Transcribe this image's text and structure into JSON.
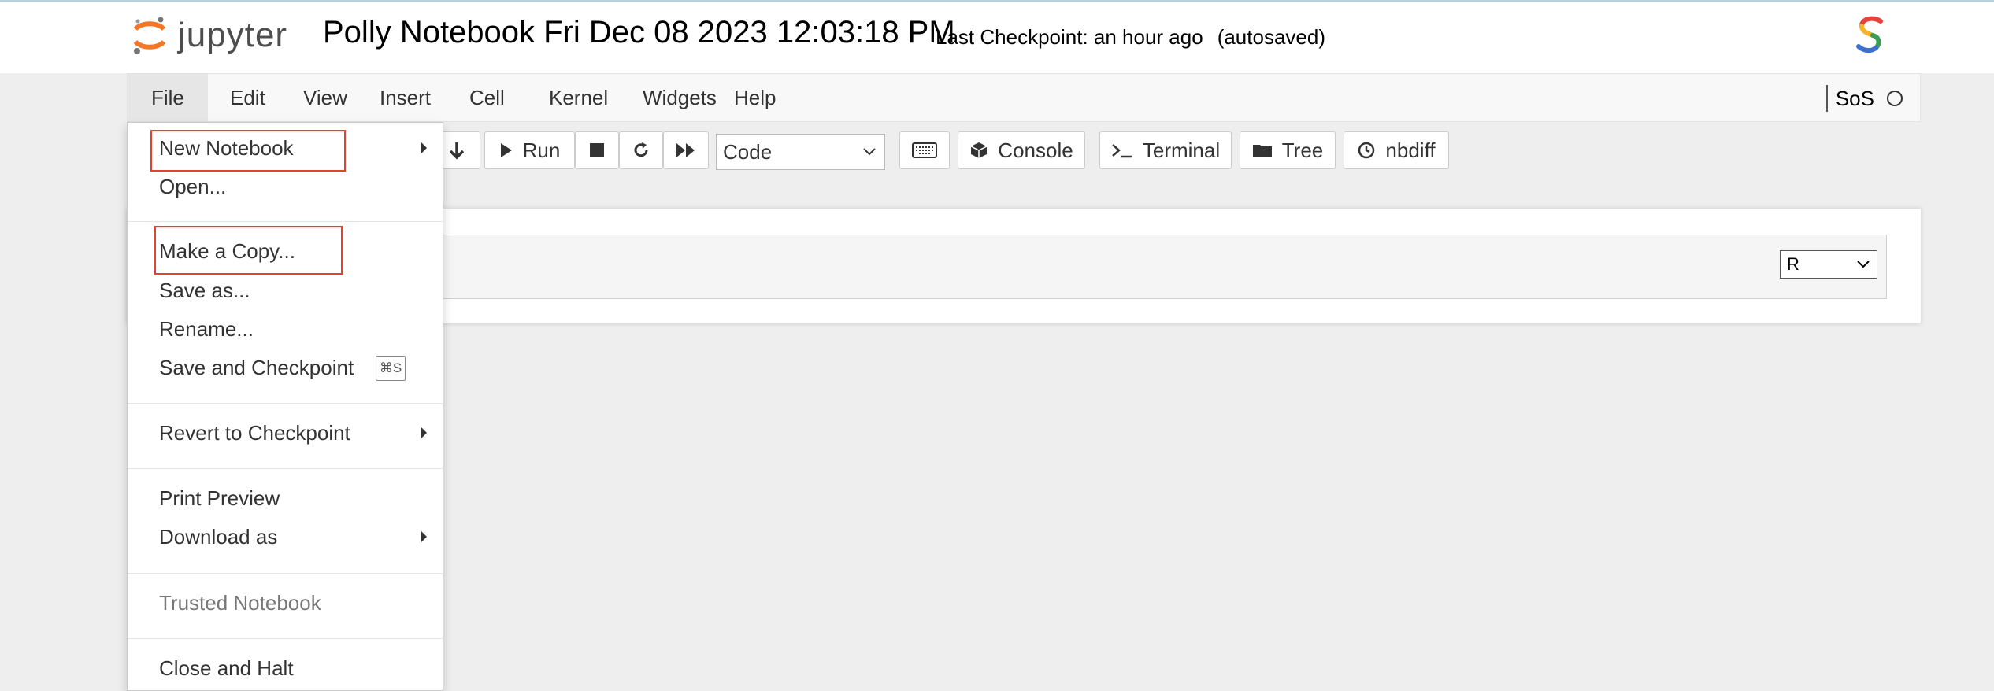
{
  "header": {
    "logo_text": "jupyter",
    "notebook_name": "Polly Notebook Fri Dec 08 2023 12:03:18 PM",
    "checkpoint": "Last Checkpoint: an hour ago",
    "autosave": "(autosaved)"
  },
  "menubar": {
    "items": [
      "File",
      "Edit",
      "View",
      "Insert",
      "Cell",
      "Kernel",
      "Widgets",
      "Help"
    ],
    "active": "File",
    "kernel_name": "SoS"
  },
  "toolbar": {
    "run_label": "Run",
    "cell_type": "Code",
    "console_label": "Console",
    "terminal_label": "Terminal",
    "tree_label": "Tree",
    "nbdiff_label": "nbdiff"
  },
  "cell": {
    "language": "R"
  },
  "file_menu": {
    "new_notebook": "New Notebook",
    "open": "Open...",
    "make_copy": "Make a Copy...",
    "save_as": "Save as...",
    "rename": "Rename...",
    "save_checkpoint": "Save and Checkpoint",
    "save_shortcut": "⌘S",
    "revert": "Revert to Checkpoint",
    "print_preview": "Print Preview",
    "download_as": "Download as",
    "trusted": "Trusted Notebook",
    "close_halt": "Close and Halt"
  },
  "colors": {
    "highlight": "#e0442e",
    "jupyter_orange": "#f37726"
  }
}
